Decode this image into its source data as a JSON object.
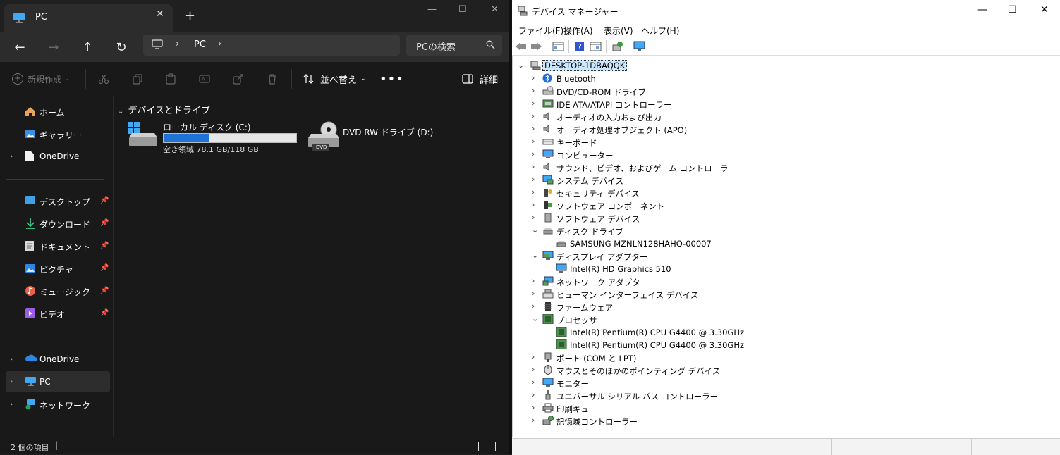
{
  "explorer": {
    "tab": {
      "title": "PC",
      "close": "✕",
      "new_tab": "+"
    },
    "window": {
      "minimize": "—",
      "maximize": "☐",
      "close": "✕"
    },
    "nav": {
      "back": "←",
      "forward": "→",
      "up": "↑",
      "refresh": "↻"
    },
    "address": {
      "separator": "›",
      "crumb": "PC"
    },
    "search": {
      "placeholder": "PCの検索"
    },
    "commands": {
      "new": "新規作成",
      "sort": "並べ替え",
      "more": "•••",
      "details": "詳細"
    },
    "sidebar": {
      "quick": [
        {
          "label": "ホーム",
          "icon": "home-icon"
        },
        {
          "label": "ギャラリー",
          "icon": "gallery-icon"
        },
        {
          "label": "OneDrive",
          "icon": "document-icon",
          "expand": "›"
        }
      ],
      "pinned": [
        {
          "label": "デスクトップ",
          "icon": "desktop-icon",
          "pin": "📌"
        },
        {
          "label": "ダウンロード",
          "icon": "download-icon",
          "pin": "📌"
        },
        {
          "label": "ドキュメント",
          "icon": "documents-icon",
          "pin": "📌"
        },
        {
          "label": "ピクチャ",
          "icon": "pictures-icon",
          "pin": "📌"
        },
        {
          "label": "ミュージック",
          "icon": "music-icon",
          "pin": "📌"
        },
        {
          "label": "ビデオ",
          "icon": "videos-icon",
          "pin": "📌"
        }
      ],
      "locations": [
        {
          "label": "OneDrive",
          "icon": "cloud-icon",
          "expand": "›"
        },
        {
          "label": "PC",
          "icon": "pc-icon",
          "expand": "›",
          "active": true
        },
        {
          "label": "ネットワーク",
          "icon": "network-icon",
          "expand": "›"
        }
      ]
    },
    "main": {
      "section_arrow": "⌄",
      "section_title": "デバイスとドライブ",
      "drives": [
        {
          "name": "ローカル ディスク (C:)",
          "free_text": "空き領域 78.1 GB/118 GB",
          "used_fraction": 0.34
        },
        {
          "name": "DVD RW ドライブ (D:)",
          "badge": "DVD"
        }
      ]
    },
    "status": {
      "count": "2 個の項目",
      "cursor": "|"
    },
    "colors": {
      "background": "#191919",
      "accent": "#1f73d6"
    }
  },
  "device_manager": {
    "title": "デバイス マネージャー",
    "window": {
      "minimize": "—",
      "maximize": "☐",
      "close": "✕"
    },
    "menu": [
      "ファイル(F)",
      "操作(A)",
      "表示(V)",
      "ヘルプ(H)"
    ],
    "tree": {
      "root": "DESKTOP-1DBAQQK",
      "collapsed_glyph": "›",
      "expanded_glyph": "⌄",
      "categories": [
        {
          "label": "Bluetooth",
          "icon": "bluetooth-icon"
        },
        {
          "label": "DVD/CD-ROM ドライブ",
          "icon": "dvd-drive-icon"
        },
        {
          "label": "IDE ATA/ATAPI コントローラー",
          "icon": "ide-controller-icon"
        },
        {
          "label": "オーディオの入力および出力",
          "icon": "speaker-icon"
        },
        {
          "label": "オーディオ処理オブジェクト (APO)",
          "icon": "speaker-icon"
        },
        {
          "label": "キーボード",
          "icon": "keyboard-icon"
        },
        {
          "label": "コンピューター",
          "icon": "computer-icon"
        },
        {
          "label": "サウンド、ビデオ、およびゲーム コントローラー",
          "icon": "speaker-icon"
        },
        {
          "label": "システム デバイス",
          "icon": "system-device-icon"
        },
        {
          "label": "セキュリティ デバイス",
          "icon": "security-key-icon"
        },
        {
          "label": "ソフトウェア コンポーネント",
          "icon": "software-component-icon"
        },
        {
          "label": "ソフトウェア デバイス",
          "icon": "software-device-icon"
        },
        {
          "label": "ディスク ドライブ",
          "icon": "disk-drive-icon",
          "expanded": true,
          "children": [
            "SAMSUNG MZNLN128HAHQ-00007"
          ]
        },
        {
          "label": "ディスプレイ アダプター",
          "icon": "display-adapter-icon",
          "expanded": true,
          "children": [
            "Intel(R) HD Graphics 510"
          ]
        },
        {
          "label": "ネットワーク アダプター",
          "icon": "network-adapter-icon"
        },
        {
          "label": "ヒューマン インターフェイス デバイス",
          "icon": "hid-icon"
        },
        {
          "label": "ファームウェア",
          "icon": "firmware-icon"
        },
        {
          "label": "プロセッサ",
          "icon": "processor-icon",
          "expanded": true,
          "children": [
            "Intel(R) Pentium(R) CPU G4400 @ 3.30GHz",
            "Intel(R) Pentium(R) CPU G4400 @ 3.30GHz"
          ]
        },
        {
          "label": "ポート (COM と LPT)",
          "icon": "port-icon"
        },
        {
          "label": "マウスとそのほかのポインティング デバイス",
          "icon": "mouse-icon"
        },
        {
          "label": "モニター",
          "icon": "monitor-icon"
        },
        {
          "label": "ユニバーサル シリアル バス コントローラー",
          "icon": "usb-icon"
        },
        {
          "label": "印刷キュー",
          "icon": "printer-icon"
        },
        {
          "label": "記憶域コントローラー",
          "icon": "storage-controller-icon"
        }
      ]
    }
  }
}
